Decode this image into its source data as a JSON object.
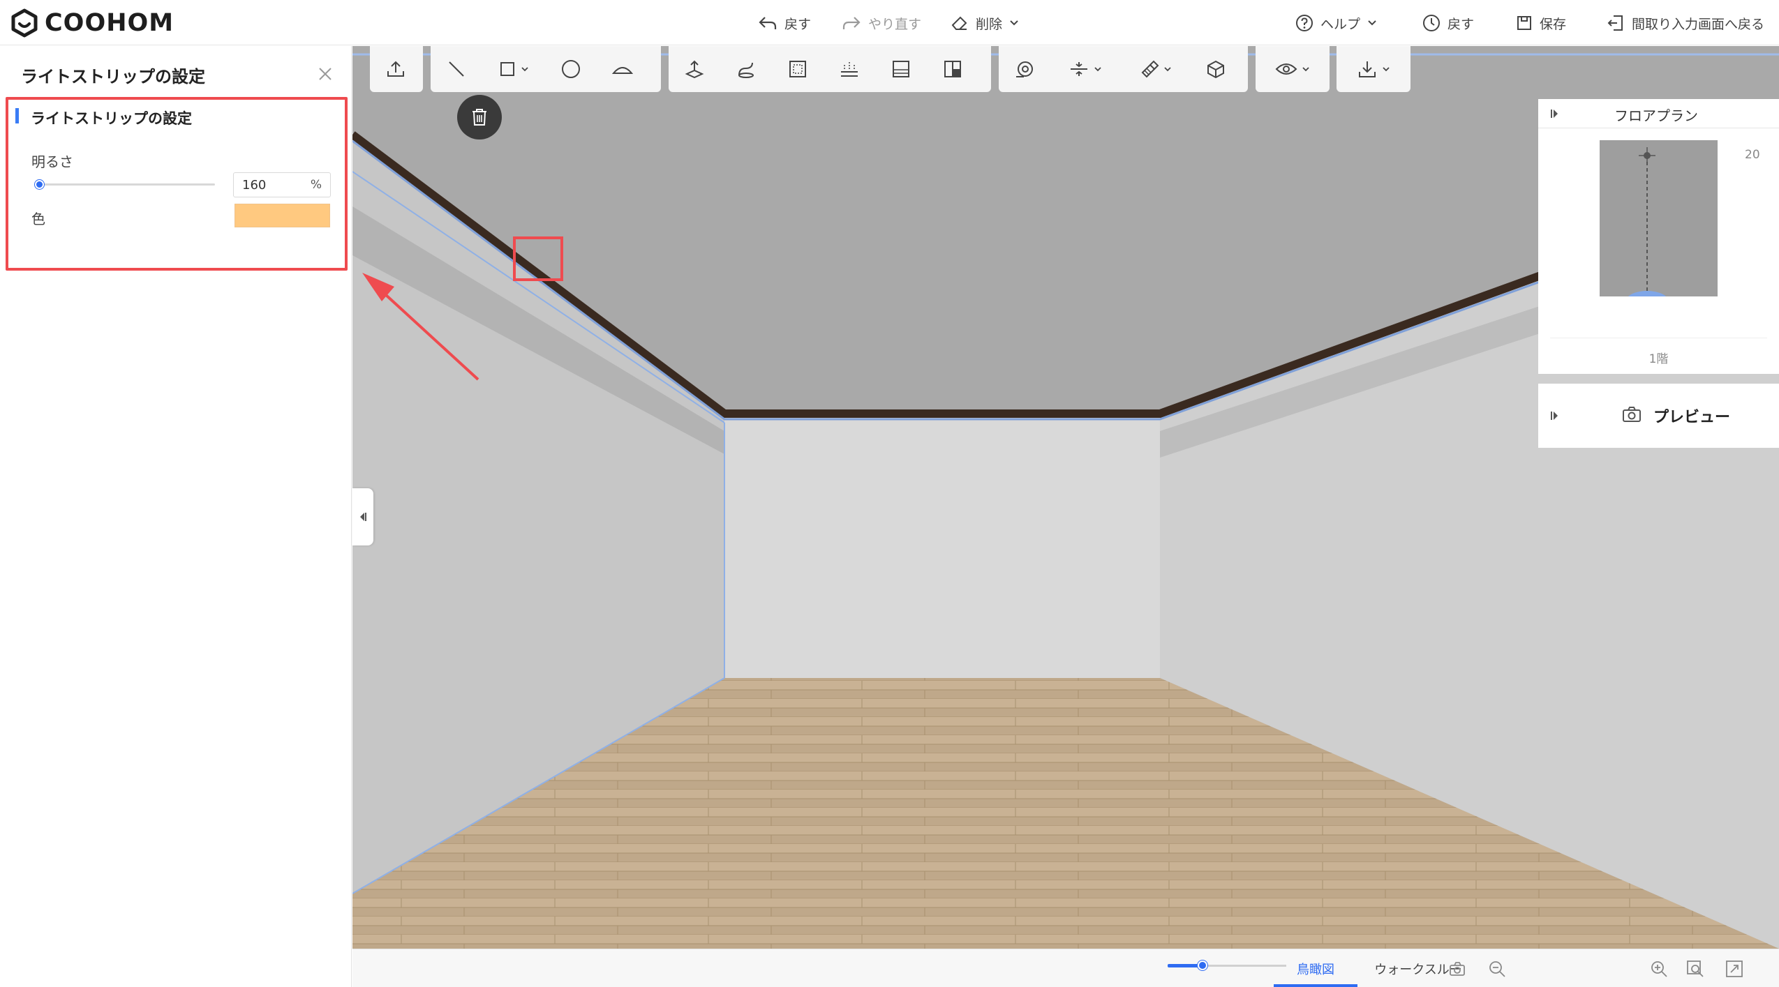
{
  "app": {
    "logo_text": "COOHOM"
  },
  "header": {
    "undo_label": "戻す",
    "redo_label": "やり直す",
    "delete_label": "削除",
    "help_label": "ヘルプ",
    "history_label": "戻す",
    "save_label": "保存",
    "back_to_plan_label": "間取り入力画面へ戻る"
  },
  "left_panel": {
    "title": "ライトストリップの設定",
    "section_title": "ライトストリップの設定",
    "brightness_label": "明るさ",
    "brightness_value": "160",
    "brightness_unit": "%",
    "color_label": "色",
    "color_value": "#ffc980"
  },
  "toolbar": {
    "tools": [
      "upload-icon",
      "line-icon",
      "rectangle-icon",
      "circle-icon",
      "arc-icon",
      "extrude-icon",
      "path-icon",
      "frame-icon",
      "light-strip-icon",
      "panel-icon",
      "split-icon",
      "sweep-icon",
      "align-icon",
      "material-icon",
      "model-icon",
      "view-icon",
      "download-icon"
    ]
  },
  "floor_plan": {
    "title": "フロアプラン",
    "scale": "20",
    "floor_label": "1階"
  },
  "preview": {
    "label": "プレビュー"
  },
  "bottom_bar": {
    "birdseye_label": "鳥瞰図",
    "walkthrough_label": "ウォークスルー"
  },
  "colors": {
    "accent": "#2f6cf2",
    "highlight": "#ef4b4f",
    "light_strip": "#ffc980"
  }
}
